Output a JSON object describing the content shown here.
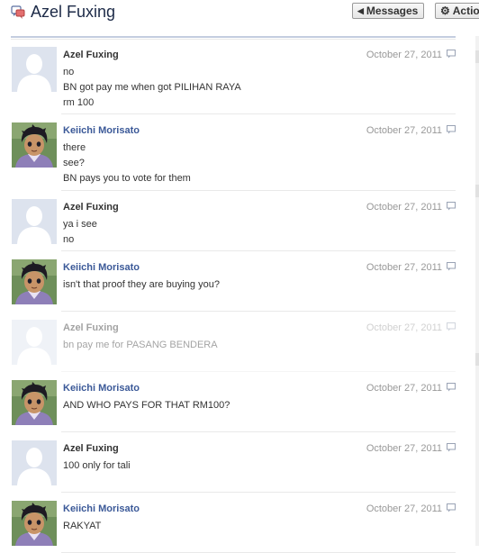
{
  "header": {
    "title": "Azel Fuxing",
    "messages_button": "Messages",
    "actions_button": "Actio"
  },
  "colors": {
    "friend_name": "#3b5998",
    "self_name": "#333333",
    "date": "#999999",
    "title": "#1c2a47"
  },
  "messages": [
    {
      "sender": "Azel Fuxing",
      "date": "October 27, 2011",
      "avatar": "default-silhouette",
      "lines": [
        "no",
        "BN got pay me when got PILIHAN RAYA",
        "rm 100"
      ]
    },
    {
      "sender": "Keiichi Morisato",
      "date": "October 27, 2011",
      "avatar": "anime-boy",
      "lines": [
        "there",
        "see?",
        "BN pays you to vote for them"
      ]
    },
    {
      "sender": "Azel Fuxing",
      "date": "October 27, 2011",
      "avatar": "default-silhouette",
      "lines": [
        "ya i see",
        "no"
      ]
    },
    {
      "sender": "Keiichi Morisato",
      "date": "October 27, 2011",
      "avatar": "anime-boy",
      "lines": [
        "isn't that proof they are buying you?"
      ]
    },
    {
      "sender": "Azel Fuxing",
      "date": "October 27, 2011",
      "avatar": "default-silhouette",
      "lines": [
        "bn pay me for PASANG BENDERA"
      ]
    },
    {
      "sender": "Keiichi Morisato",
      "date": "October 27, 2011",
      "avatar": "anime-boy",
      "lines": [
        "AND WHO PAYS FOR THAT RM100?"
      ]
    },
    {
      "sender": "Azel Fuxing",
      "date": "October 27, 2011",
      "avatar": "default-silhouette",
      "lines": [
        "100 only for tali"
      ]
    },
    {
      "sender": "Keiichi Morisato",
      "date": "October 27, 2011",
      "avatar": "anime-boy",
      "lines": [
        "RAKYAT"
      ]
    }
  ]
}
